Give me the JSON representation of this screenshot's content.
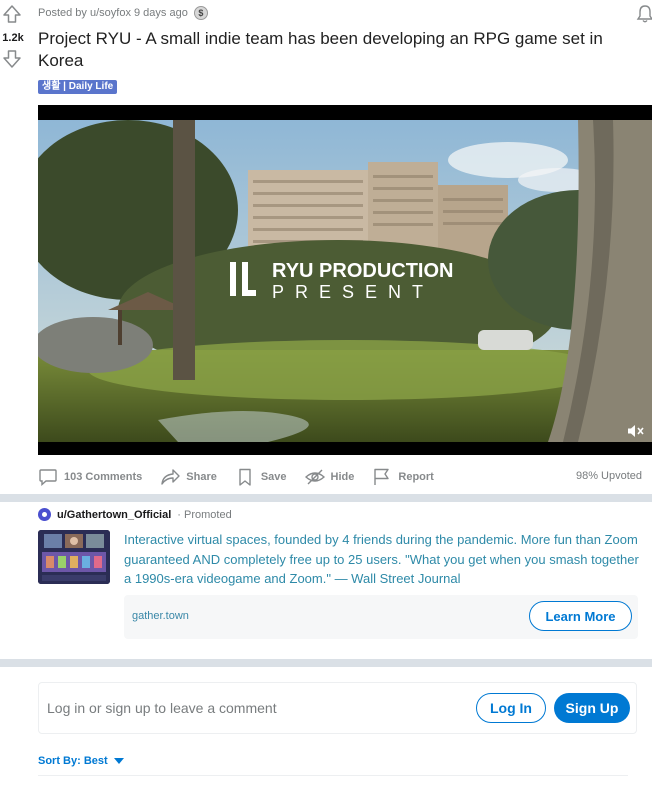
{
  "post": {
    "score": "1.2k",
    "meta": "Posted by u/soyfox 9 days ago",
    "award_glyph": "$",
    "title": "Project RYU - A small indie team has been developing an RPG game set in Korea",
    "flair": "생활 | Daily Life",
    "video": {
      "overlay_line1": "RYU PRODUCTION",
      "overlay_line2": "PRESENT",
      "muted": true
    },
    "actions": {
      "comments": "103 Comments",
      "share": "Share",
      "save": "Save",
      "hide": "Hide",
      "report": "Report"
    },
    "upvoted": "98% Upvoted"
  },
  "promoted": {
    "user": "u/Gathertown_Official",
    "tag": "· Promoted",
    "text": "Interactive virtual spaces, founded by 4 friends during the pandemic. More fun than Zoom guaranteed AND completely free up to 25 users. \"What you get when you smash together a 1990s-era videogame and Zoom.\" — Wall Street Journal",
    "domain": "gather.town",
    "cta": "Learn More"
  },
  "comments": {
    "prompt": "Log in or sign up to leave a comment",
    "login": "Log In",
    "signup": "Sign Up",
    "sort": "Sort By: Best"
  },
  "colors": {
    "accent": "#0079d3",
    "flair_bg": "#5a75cc",
    "separator": "#dae0e6",
    "muted_text": "#787c7e"
  }
}
